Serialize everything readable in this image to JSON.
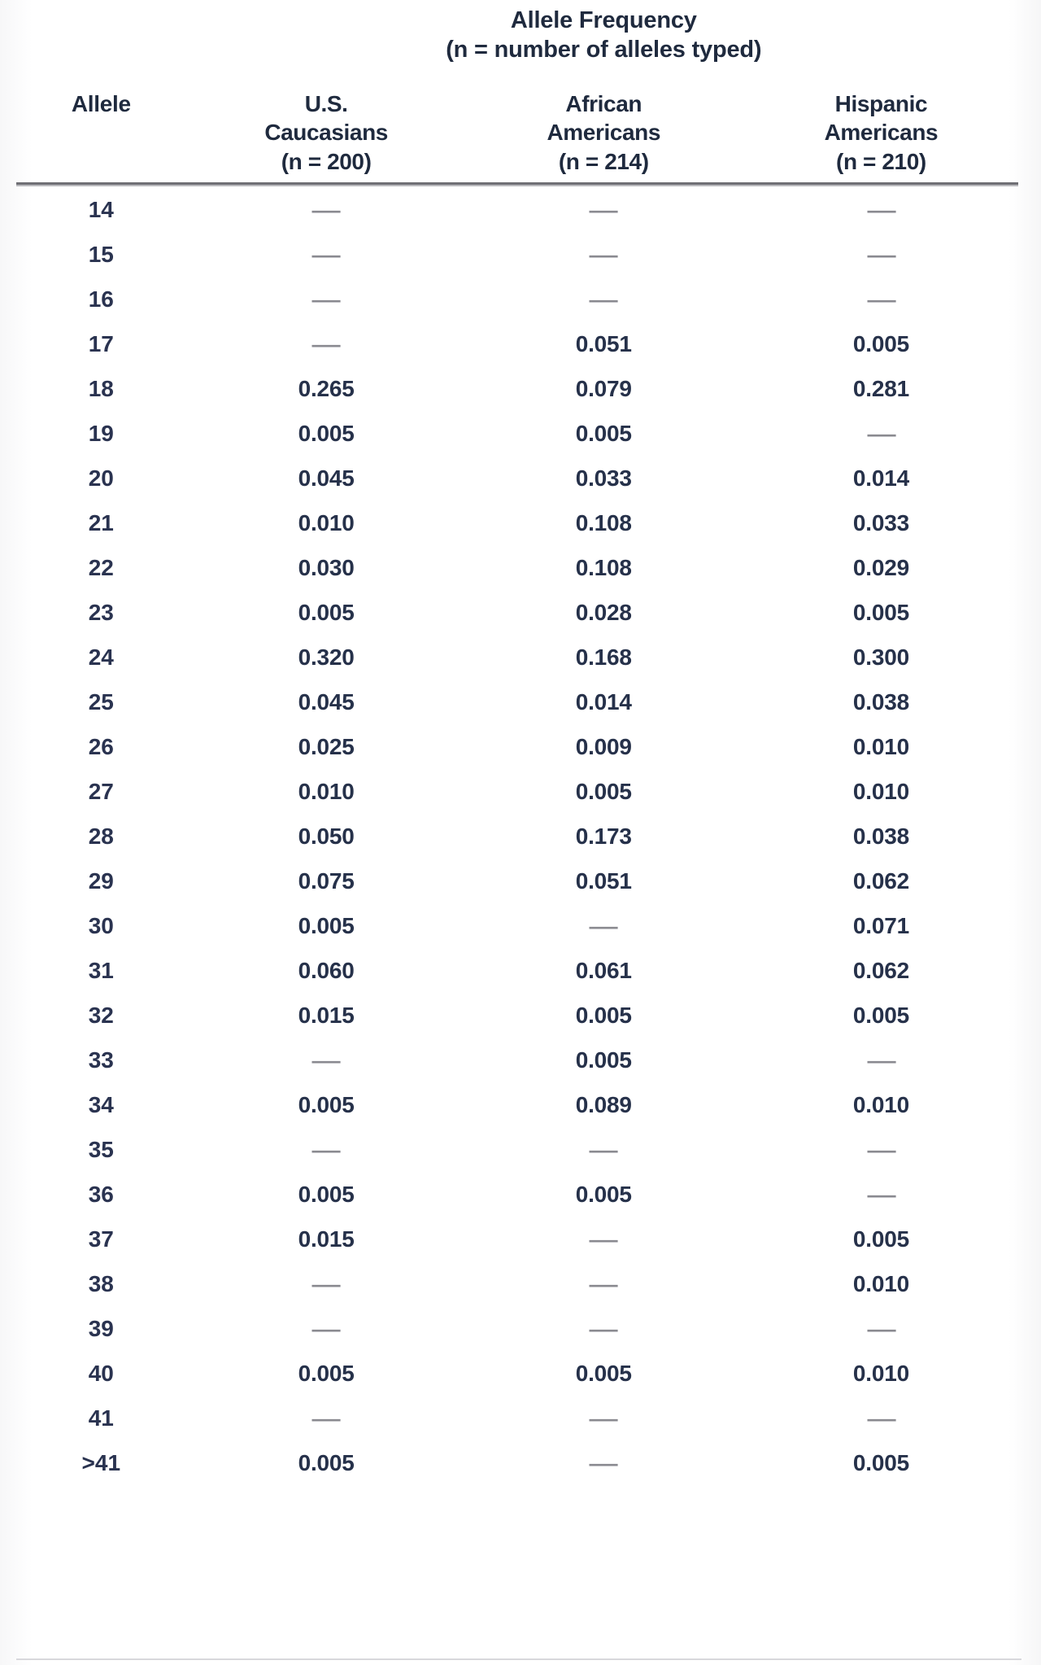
{
  "table": {
    "title_line1": "Allele Frequency",
    "title_line2": "(n = number of alleles typed)",
    "columns": [
      {
        "key": "allele",
        "header_line1": "Allele",
        "header_line2": "",
        "header_n": ""
      },
      {
        "key": "us_caucasians",
        "header_line1": "U.S.",
        "header_line2": "Caucasians",
        "header_n": "(n = 200)"
      },
      {
        "key": "african_americans",
        "header_line1": "African",
        "header_line2": "Americans",
        "header_n": "(n = 214)"
      },
      {
        "key": "hispanic_americans",
        "header_line1": "Hispanic",
        "header_line2": "Americans",
        "header_n": "(n = 210)"
      }
    ],
    "absent_marker": "—",
    "rows": [
      {
        "allele": "14",
        "us_caucasians": "—",
        "african_americans": "—",
        "hispanic_americans": "—"
      },
      {
        "allele": "15",
        "us_caucasians": "—",
        "african_americans": "—",
        "hispanic_americans": "—"
      },
      {
        "allele": "16",
        "us_caucasians": "—",
        "african_americans": "—",
        "hispanic_americans": "—"
      },
      {
        "allele": "17",
        "us_caucasians": "—",
        "african_americans": "0.051",
        "hispanic_americans": "0.005"
      },
      {
        "allele": "18",
        "us_caucasians": "0.265",
        "african_americans": "0.079",
        "hispanic_americans": "0.281"
      },
      {
        "allele": "19",
        "us_caucasians": "0.005",
        "african_americans": "0.005",
        "hispanic_americans": "—"
      },
      {
        "allele": "20",
        "us_caucasians": "0.045",
        "african_americans": "0.033",
        "hispanic_americans": "0.014"
      },
      {
        "allele": "21",
        "us_caucasians": "0.010",
        "african_americans": "0.108",
        "hispanic_americans": "0.033"
      },
      {
        "allele": "22",
        "us_caucasians": "0.030",
        "african_americans": "0.108",
        "hispanic_americans": "0.029"
      },
      {
        "allele": "23",
        "us_caucasians": "0.005",
        "african_americans": "0.028",
        "hispanic_americans": "0.005"
      },
      {
        "allele": "24",
        "us_caucasians": "0.320",
        "african_americans": "0.168",
        "hispanic_americans": "0.300"
      },
      {
        "allele": "25",
        "us_caucasians": "0.045",
        "african_americans": "0.014",
        "hispanic_americans": "0.038"
      },
      {
        "allele": "26",
        "us_caucasians": "0.025",
        "african_americans": "0.009",
        "hispanic_americans": "0.010"
      },
      {
        "allele": "27",
        "us_caucasians": "0.010",
        "african_americans": "0.005",
        "hispanic_americans": "0.010"
      },
      {
        "allele": "28",
        "us_caucasians": "0.050",
        "african_americans": "0.173",
        "hispanic_americans": "0.038"
      },
      {
        "allele": "29",
        "us_caucasians": "0.075",
        "african_americans": "0.051",
        "hispanic_americans": "0.062"
      },
      {
        "allele": "30",
        "us_caucasians": "0.005",
        "african_americans": "—",
        "hispanic_americans": "0.071"
      },
      {
        "allele": "31",
        "us_caucasians": "0.060",
        "african_americans": "0.061",
        "hispanic_americans": "0.062"
      },
      {
        "allele": "32",
        "us_caucasians": "0.015",
        "african_americans": "0.005",
        "hispanic_americans": "0.005"
      },
      {
        "allele": "33",
        "us_caucasians": "—",
        "african_americans": "0.005",
        "hispanic_americans": "—"
      },
      {
        "allele": "34",
        "us_caucasians": "0.005",
        "african_americans": "0.089",
        "hispanic_americans": "0.010"
      },
      {
        "allele": "35",
        "us_caucasians": "—",
        "african_americans": "—",
        "hispanic_americans": "—"
      },
      {
        "allele": "36",
        "us_caucasians": "0.005",
        "african_americans": "0.005",
        "hispanic_americans": "—"
      },
      {
        "allele": "37",
        "us_caucasians": "0.015",
        "african_americans": "—",
        "hispanic_americans": "0.005"
      },
      {
        "allele": "38",
        "us_caucasians": "—",
        "african_americans": "—",
        "hispanic_americans": "0.010"
      },
      {
        "allele": "39",
        "us_caucasians": "—",
        "african_americans": "—",
        "hispanic_americans": "—"
      },
      {
        "allele": "40",
        "us_caucasians": "0.005",
        "african_americans": "0.005",
        "hispanic_americans": "0.010"
      },
      {
        "allele": "41",
        "us_caucasians": "—",
        "african_americans": "—",
        "hispanic_americans": "—"
      },
      {
        "allele": ">41",
        "us_caucasians": "0.005",
        "african_americans": "—",
        "hispanic_americans": "0.005"
      }
    ]
  },
  "colors": {
    "ink": "#26314a",
    "dash": "#8a8a90",
    "rule": "#6f6f74",
    "page": "#fdfdfd"
  }
}
